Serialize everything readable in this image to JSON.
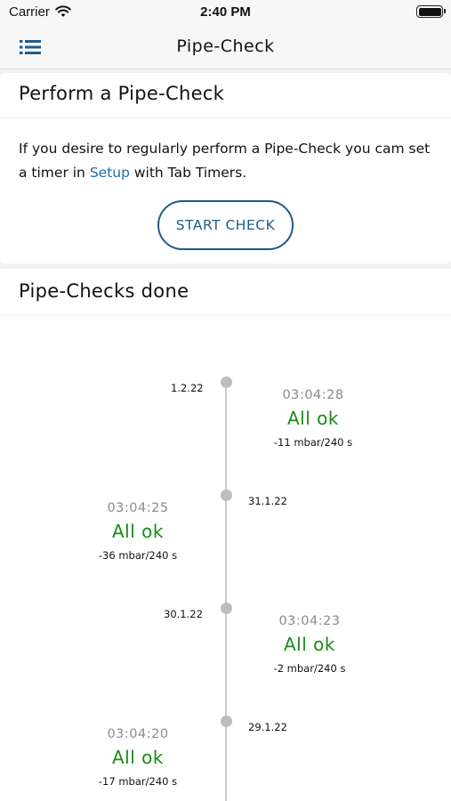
{
  "status_bar": {
    "carrier": "Carrier",
    "time": "2:40 PM"
  },
  "nav": {
    "title": "Pipe-Check",
    "menu_icon": "list-icon"
  },
  "perform": {
    "title": "Perform a Pipe-Check",
    "text_before": "If you desire to regularly perform a Pipe-Check you cam set a timer in ",
    "link": "Setup",
    "text_after": " with Tab Timers.",
    "button": "START CHECK"
  },
  "history": {
    "title": "Pipe-Checks done",
    "entries": [
      {
        "date": "1.2.22",
        "time": "03:04:28",
        "status": "All ok",
        "value": "-11 mbar/240 s"
      },
      {
        "date": "31.1.22",
        "time": "03:04:25",
        "status": "All ok",
        "value": "-36 mbar/240 s"
      },
      {
        "date": "30.1.22",
        "time": "03:04:23",
        "status": "All ok",
        "value": "-2 mbar/240 s"
      },
      {
        "date": "29.1.22",
        "time": "03:04:20",
        "status": "All ok",
        "value": "-17 mbar/240 s"
      }
    ]
  },
  "colors": {
    "accent": "#1f5a8a",
    "link": "#1f6ea7",
    "ok": "#1a8a1a",
    "timeline": "#c9c9cd"
  }
}
